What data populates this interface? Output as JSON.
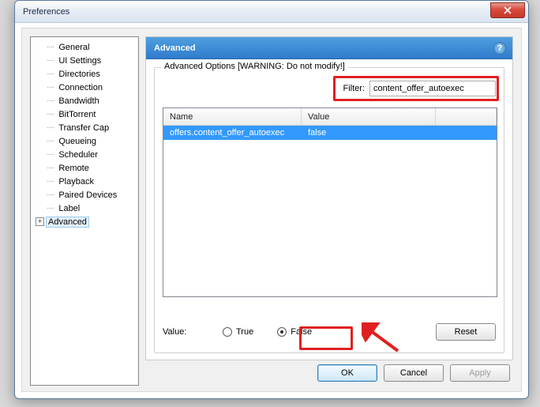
{
  "window": {
    "title": "Preferences"
  },
  "tree": {
    "items": [
      "General",
      "UI Settings",
      "Directories",
      "Connection",
      "Bandwidth",
      "BitTorrent",
      "Transfer Cap",
      "Queueing",
      "Scheduler",
      "Remote",
      "Playback",
      "Paired Devices",
      "Label"
    ],
    "expandable": "Advanced"
  },
  "panel": {
    "title": "Advanced"
  },
  "fieldset": {
    "legend": "Advanced Options [WARNING: Do not modify!]"
  },
  "filter": {
    "label": "Filter:",
    "value": "content_offer_autoexec"
  },
  "grid": {
    "cols": {
      "name": "Name",
      "value": "Value"
    },
    "row": {
      "name": "offers.content_offer_autoexec",
      "value": "false"
    }
  },
  "valueRow": {
    "label": "Value:",
    "true": "True",
    "false": "False",
    "reset": "Reset"
  },
  "buttons": {
    "ok": "OK",
    "cancel": "Cancel",
    "apply": "Apply"
  }
}
